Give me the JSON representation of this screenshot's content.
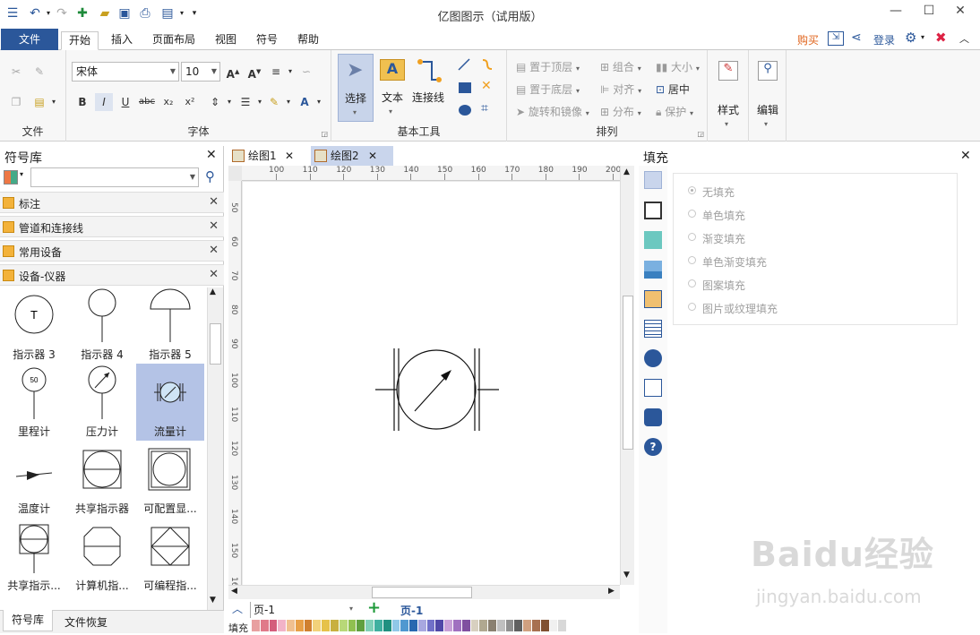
{
  "app": {
    "title": "亿图图示（试用版）"
  },
  "menu": {
    "file": "文件",
    "tabs": [
      "开始",
      "插入",
      "页面布局",
      "视图",
      "符号",
      "帮助"
    ],
    "active_tab": "开始"
  },
  "right_menu": {
    "buy": "购买",
    "login": "登录"
  },
  "ribbon": {
    "groups": {
      "file": "文件",
      "font": "字体",
      "basic_tools": "基本工具",
      "arrange": "排列"
    },
    "font_name": "宋体",
    "font_size": "10",
    "tools": {
      "select": "选择",
      "text": "文本",
      "connector": "连接线"
    },
    "arrange_items": [
      "置于顶层",
      "置于底层",
      "旋转和镜像",
      "组合",
      "对齐",
      "分布",
      "大小",
      "居中",
      "保护"
    ],
    "style": "样式",
    "edit": "编辑"
  },
  "library": {
    "title": "符号库",
    "search_placeholder": "",
    "categories": [
      "标注",
      "管道和连接线",
      "常用设备",
      "设备-仪器"
    ],
    "shapes": [
      "指示器 3",
      "指示器 4",
      "指示器 5",
      "里程计",
      "压力计",
      "流量计",
      "温度计",
      "共享指示器",
      "可配置显...",
      "共享指示...",
      "计算机指...",
      "可编程指..."
    ],
    "selected_shape": "流量计",
    "odometer_value": "50",
    "indicator3_letter": "T",
    "bottom_tabs": [
      "符号库",
      "文件恢复"
    ]
  },
  "documents": {
    "tabs": [
      "绘图1",
      "绘图2"
    ],
    "active": "绘图2"
  },
  "rulers": {
    "h": [
      "100",
      "110",
      "120",
      "130",
      "140",
      "150",
      "160",
      "170",
      "180",
      "190",
      "200"
    ],
    "v": [
      "50",
      "60",
      "70",
      "80",
      "90",
      "100",
      "110",
      "120",
      "130",
      "140",
      "150",
      "160"
    ]
  },
  "pagebar": {
    "page_select": "页-1",
    "page_tab": "页-1",
    "fill_label": "填充"
  },
  "fill_panel": {
    "title": "填充",
    "options": [
      "无填充",
      "单色填充",
      "渐变填充",
      "单色渐变填充",
      "图案填充",
      "图片或纹理填充"
    ],
    "selected": "无填充"
  },
  "watermark": {
    "brand": "Baidu经验",
    "url": "jingyan.baidu.com"
  },
  "colors": {
    "accent": "#2b579a",
    "selection": "#b4c3e6",
    "buy": "#e0641c",
    "palette": [
      "#e8a0a0",
      "#e07a8a",
      "#d45d7c",
      "#f2b3c8",
      "#f0c090",
      "#e8a048",
      "#d08030",
      "#f2d27a",
      "#e6c24a",
      "#c8b040",
      "#b8d878",
      "#90c050",
      "#60a040",
      "#80d0b8",
      "#40b0a0",
      "#209080",
      "#90c8e8",
      "#5098d0",
      "#2868b0",
      "#a8a8e0",
      "#7070c8",
      "#5048a8",
      "#c8a0d8",
      "#a070c0",
      "#8050a0",
      "#d8d0c0",
      "#b0a890",
      "#8a8070",
      "#c0c0c0",
      "#909090",
      "#606060",
      "#d0a080",
      "#a87050",
      "#805030",
      "#f0f0f0",
      "#d8d8d8"
    ]
  }
}
